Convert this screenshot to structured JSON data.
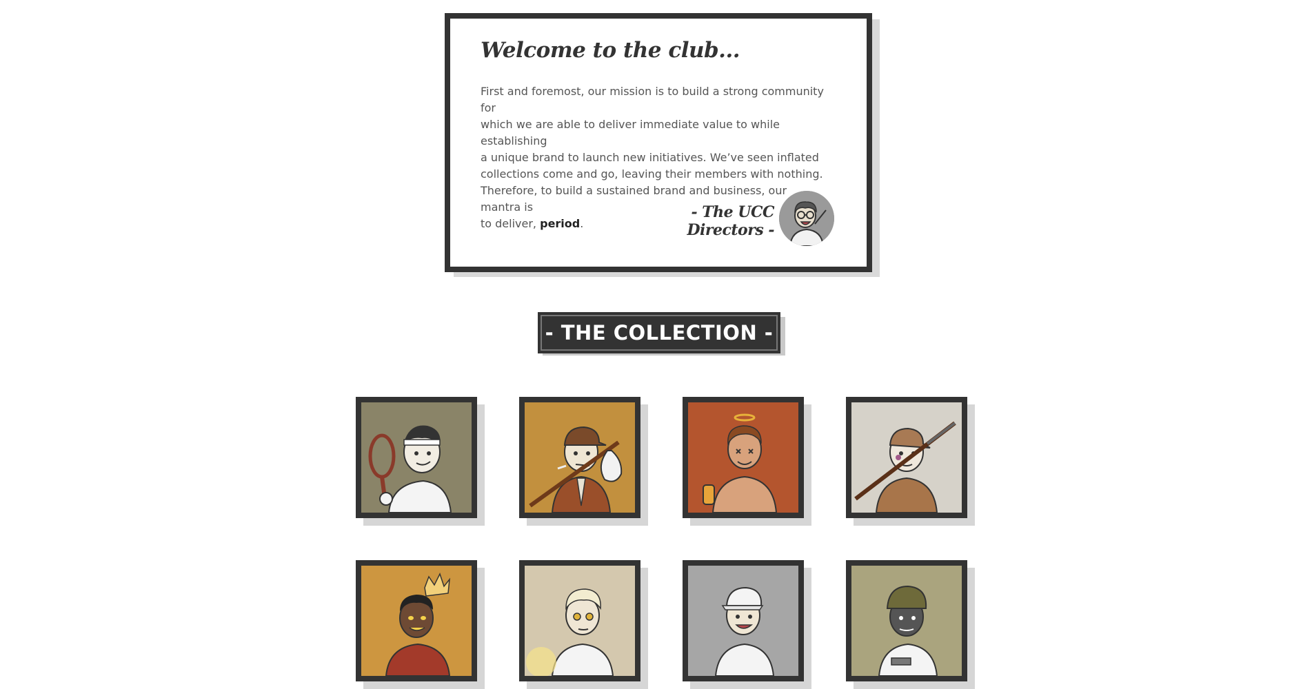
{
  "welcome": {
    "title": "Welcome to the club...",
    "body_lines": [
      "First and foremost, our mission is to build a strong community for",
      "which we are able to deliver immediate value to while establishing",
      "a unique brand to launch new initiatives. We’ve seen inflated",
      "collections come and go, leaving their members with nothing.",
      "Therefore, to build a sustained brand and business, our mantra is",
      "to deliver, "
    ],
    "body_emphasis": "period",
    "body_end": ".",
    "signature": "- The UCC Directors -"
  },
  "collection": {
    "heading": "- THE COLLECTION -",
    "items": [
      {
        "name": "tennis-player",
        "bg": "#8a8468"
      },
      {
        "name": "traveler-with-bindle",
        "bg": "#c2903e"
      },
      {
        "name": "halo-shirtless",
        "bg": "#b4552e"
      },
      {
        "name": "hunter-with-shotgun",
        "bg": "#d6d2c9"
      },
      {
        "name": "king-with-crown",
        "bg": "#cd9640"
      },
      {
        "name": "blond-glowing-hand",
        "bg": "#d4c8ae"
      },
      {
        "name": "white-cap",
        "bg": "#a6a6a6"
      },
      {
        "name": "soldier-helmet",
        "bg": "#aaa47e"
      }
    ]
  },
  "colors": {
    "dark": "#333333",
    "text": "#555555",
    "shadow": "#d9d9d9"
  }
}
